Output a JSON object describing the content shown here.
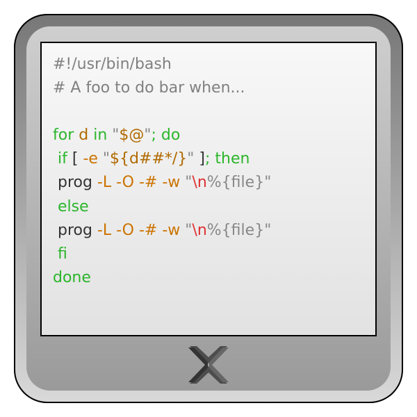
{
  "code": {
    "line1": {
      "shebang": "#!/usr/bin/bash"
    },
    "line2": {
      "comment": "# A foo to do bar when..."
    },
    "line3": {
      "kw_for": "for",
      "var_d": "d",
      "kw_in": "in",
      "q": "\"",
      "var_args": "$@",
      "q2": "\"",
      "semi_do": "; do"
    },
    "line4": {
      "kw_if": " if",
      "lbr": " [ ",
      "flag_e": "-e",
      "sp": " ",
      "q": "\"",
      "expand": "${d##*/}",
      "q2": "\"",
      "rbr": " ]",
      "semi_then": "; then"
    },
    "line5": {
      "cmd": " prog",
      "flags": " -L -O -# -w ",
      "q": "\"",
      "esc": "\\n",
      "rest": "%{file}",
      "q2": "\""
    },
    "line6": {
      "kw_else": " else"
    },
    "line7": {
      "cmd": " prog",
      "flags": " -L -O -# -w ",
      "q": "\"",
      "esc": "\\n",
      "rest": "%{file}",
      "q2": "\""
    },
    "line8": {
      "kw_fi": " fi"
    },
    "line9": {
      "kw_done": "done"
    }
  }
}
